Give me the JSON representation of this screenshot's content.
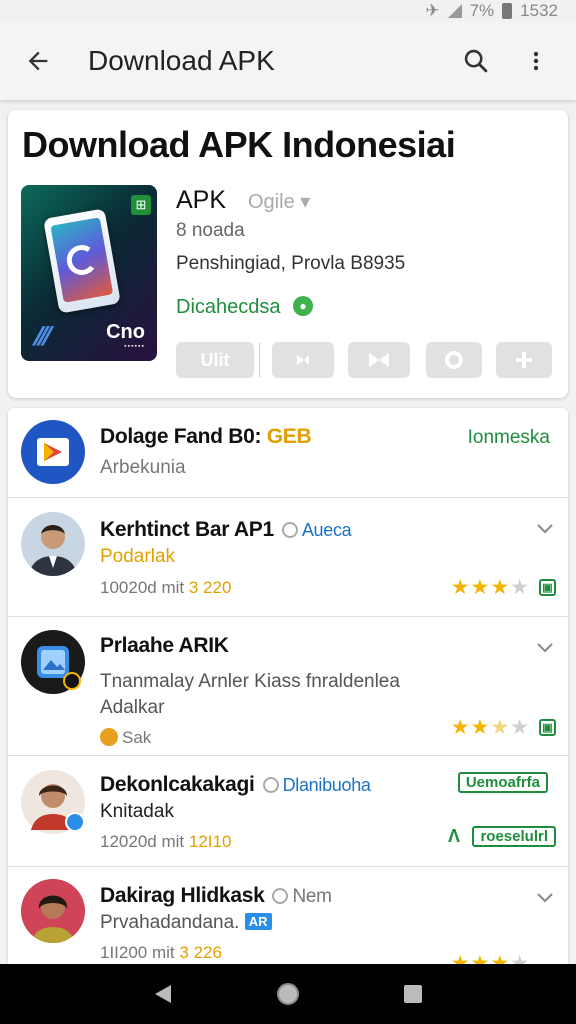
{
  "status_bar": {
    "battery": "7%",
    "time": "1532"
  },
  "app_bar": {
    "title": "Download APK"
  },
  "hero": {
    "heading": "Download APK Indonesiai",
    "app_name": "APK",
    "developer": "Ogile ▾",
    "size": "8 noada",
    "publisher": "Penshingiad, Provla B8935",
    "status": "Dicahecdsa",
    "icon_brand": "Cno",
    "actions": [
      {
        "label": "Ulit",
        "icon": "text-button"
      },
      {
        "label": "",
        "icon": "swap-icon"
      },
      {
        "label": "",
        "icon": "bowtie-icon"
      },
      {
        "label": "",
        "icon": "clock-icon"
      },
      {
        "label": "",
        "icon": "plus-icon"
      }
    ]
  },
  "list": [
    {
      "title": "Dolage Fand B0:",
      "title_badge": "GEB",
      "subtitle": "Arbekunia",
      "right_label": "Ionmeska",
      "icon": "play-store-icon"
    },
    {
      "title": "Kerhtinct Bar AP1",
      "tag": "Aueca",
      "subtitle": "Podarlak",
      "meta_text": "10020d mit",
      "meta_num": "3 220",
      "rating": 3,
      "max_rating": 5
    },
    {
      "title": "Prlaahe ARIK",
      "subtitle": "Tnanmalay Arnler Kiass fnraldenlea",
      "subtitle2": "Adalkar",
      "meta_text": "Sak",
      "rating": 2.5,
      "max_rating": 5,
      "icon": "image-app-icon"
    },
    {
      "title": "Dekonlcakakagi",
      "tag": "Dlanibuoha",
      "subtitle": "Knitadak",
      "meta_text": "12020d mit",
      "meta_num": "12I10",
      "badge_top": "Uemoafrfa",
      "badge_bottom": "roeselulrl"
    },
    {
      "title": "Dakirag Hlidkask",
      "tag": "Nem",
      "subtitle": "Prvahadandana.",
      "subtitle_chip": "AR",
      "meta_text": "1II200 mit",
      "meta_num": "3 226",
      "rating": 3,
      "max_rating": 5
    }
  ],
  "colors": {
    "accent_green": "#1e8e3e",
    "accent_blue": "#1a73c8",
    "star": "#f5b400"
  }
}
